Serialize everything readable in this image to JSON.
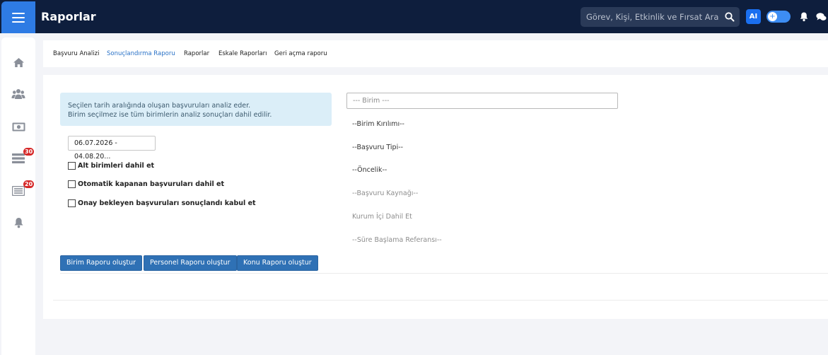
{
  "header": {
    "title": "Raporlar",
    "search_placeholder": "Görev, Kişi, Etkinlik ve Fırsat Ara",
    "ai_label": "AI"
  },
  "sidebar": {
    "items": [
      {
        "icon": "home-icon"
      },
      {
        "icon": "users-icon"
      },
      {
        "icon": "money-icon"
      },
      {
        "icon": "list-icon",
        "badge": "30"
      },
      {
        "icon": "news-icon",
        "badge": "20"
      },
      {
        "icon": "bell-icon"
      }
    ]
  },
  "tabs": [
    {
      "label": "Başvuru Analizi",
      "active": false
    },
    {
      "label": "Sonuçlandırma Raporu",
      "active": true
    },
    {
      "label": "Raporlar",
      "active": false
    },
    {
      "label": "Eskale Raporları",
      "active": false
    },
    {
      "label": "Geri açma raporu",
      "active": false
    }
  ],
  "form": {
    "info_line1": "Seçilen tarih aralığında oluşan başvuruları analiz eder.",
    "info_line2": "Birim seçilmez ise tüm birimlerin analiz sonuçları dahil edilir.",
    "date_range": "06.07.2026 - 04.08.20...",
    "checkboxes": [
      {
        "label": "Alt birimleri dahil et",
        "checked": false
      },
      {
        "label": "Otomatik kapanan başvuruları dahil et",
        "checked": false
      },
      {
        "label": "Onay bekleyen başvuruları sonuçlandı kabul et",
        "checked": false
      }
    ],
    "birim_placeholder": "--- Birim ---",
    "options": [
      "--Birim Kırılımı--",
      "--Başvuru Tipi--",
      "--Öncelik--",
      "--Başvuru Kaynağı--",
      "Kurum İçi Dahil Et",
      "--Süre Başlama Referansı--"
    ],
    "buttons": [
      "Birim Raporu oluştur",
      "Personel Raporu oluştur",
      "Konu Raporu oluştur"
    ]
  },
  "colors": {
    "topbar": "#0e1e3d",
    "accent": "#2e7be4",
    "button": "#2f71b5",
    "info_bg": "#dbeef8",
    "badge": "#d62828"
  }
}
